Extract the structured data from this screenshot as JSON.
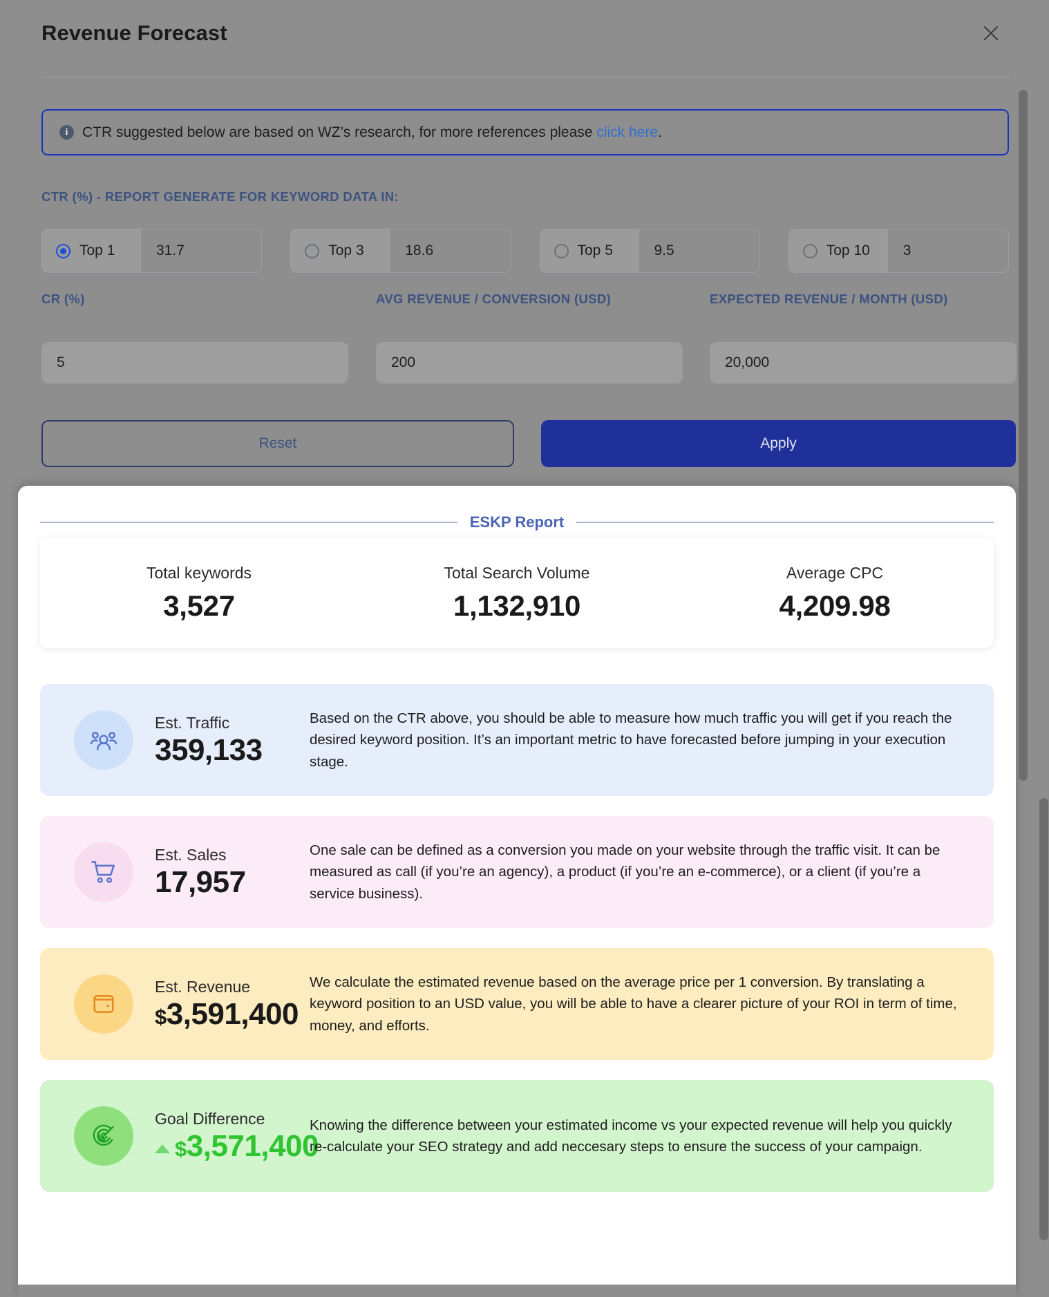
{
  "dialog": {
    "title": "Revenue Forecast",
    "close_icon": "close-icon"
  },
  "info_banner": {
    "icon": "info-icon",
    "text_before": "CTR suggested below are based on WZ’s research, for more references please ",
    "link_label": "click here",
    "text_after": "."
  },
  "ctr_section": {
    "label": "CTR (%) - REPORT GENERATE FOR KEYWORD DATA IN:",
    "options": [
      {
        "label": "Top 1",
        "value": "31.7",
        "selected": true
      },
      {
        "label": "Top 3",
        "value": "18.6",
        "selected": false
      },
      {
        "label": "Top 5",
        "value": "9.5",
        "selected": false
      },
      {
        "label": "Top 10",
        "value": "3",
        "selected": false
      }
    ]
  },
  "inputs": {
    "cr": {
      "label": "CR (%)",
      "value": "5"
    },
    "avg_revenue": {
      "label": "AVG REVENUE / CONVERSION (USD)",
      "value": "200"
    },
    "expected_revenue": {
      "label": "EXPECTED REVENUE / MONTH (USD)",
      "value": "20,000"
    }
  },
  "actions": {
    "reset_label": "Reset",
    "apply_label": "Apply"
  },
  "report": {
    "heading": "ESKP Report",
    "summary": [
      {
        "label": "Total keywords",
        "value": "3,527"
      },
      {
        "label": "Total Search Volume",
        "value": "1,132,910"
      },
      {
        "label": "Average CPC",
        "value": "4,209.98"
      }
    ],
    "metrics": [
      {
        "icon": "users-group-icon",
        "title": "Est. Traffic",
        "currency": "",
        "value": "359,133",
        "description": "Based on the CTR above, you should be able to measure how much traffic you will get if you reach the desired keyword position. It’s an important metric to have forecasted before jumping in your execution stage."
      },
      {
        "icon": "shopping-cart-icon",
        "title": "Est. Sales",
        "currency": "",
        "value": "17,957",
        "description": "One sale can be defined as a conversion you made on your website through the traffic visit. It can be measured as call (if you’re an agency), a product (if you’re an e-commerce), or a client (if you’re a service business)."
      },
      {
        "icon": "wallet-icon",
        "title": "Est. Revenue",
        "currency": "$",
        "value": "3,591,400",
        "description": "We calculate the estimated revenue based on the average price per 1 conversion. By translating a keyword position to an USD value, you will be able to have a clearer picture of your ROI in term of time, money, and efforts."
      },
      {
        "icon": "target-click-icon",
        "title": "Goal Difference",
        "currency": "$",
        "value": "3,571,400",
        "description": "Knowing the difference between your estimated income vs your expected revenue will help you quickly re-calculate your SEO strategy and add neccesary steps to ensure the success of your campaign."
      }
    ]
  },
  "colors": {
    "primary": "#20309a",
    "link": "#2f6fd0",
    "label": "#3c5280",
    "report_heading": "#4a63b5",
    "traffic_bg": "#e6edfb",
    "sales_bg": "#fcecf8",
    "revenue_bg": "#fdecbf",
    "goal_bg": "#d3f5ce",
    "goal_value": "#2fc430"
  }
}
